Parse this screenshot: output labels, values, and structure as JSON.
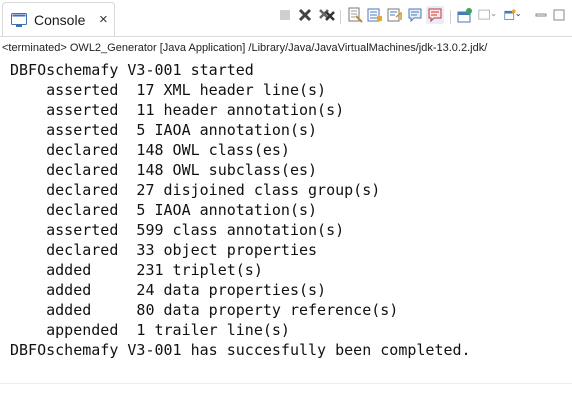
{
  "tab": {
    "label": "Console",
    "close": "×",
    "icon": "console-icon"
  },
  "toolbar": {
    "icons": [
      "terminate-icon",
      "remove-launch-icon",
      "remove-all-terminated-icon",
      "clear-console-icon",
      "scroll-lock-icon",
      "word-wrap-icon",
      "show-on-stdout-icon",
      "show-on-stderr-icon",
      "pin-console-icon",
      "display-selected-console-icon",
      "open-console-icon",
      "minimize-icon",
      "maximize-icon"
    ]
  },
  "info": {
    "text": "<terminated> OWL2_Generator [Java Application] /Library/Java/JavaVirtualMachines/jdk-13.0.2.jdk/"
  },
  "console": {
    "lines": [
      "DBFOschemafy V3-001 started",
      "    asserted  17 XML header line(s)",
      "    asserted  11 header annotation(s)",
      "    asserted  5 IAOA annotation(s)",
      "    declared  148 OWL class(es)",
      "    declared  148 OWL subclass(es)",
      "    declared  27 disjoined class group(s)",
      "    declared  5 IAOA annotation(s)",
      "    asserted  599 class annotation(s)",
      "    declared  33 object properties",
      "    added     231 triplet(s)",
      "    added     24 data properties(s)",
      "    added     80 data property reference(s)",
      "    appended  1 trailer line(s)",
      "DBFOschemafy V3-001 has succesfully been completed."
    ]
  }
}
